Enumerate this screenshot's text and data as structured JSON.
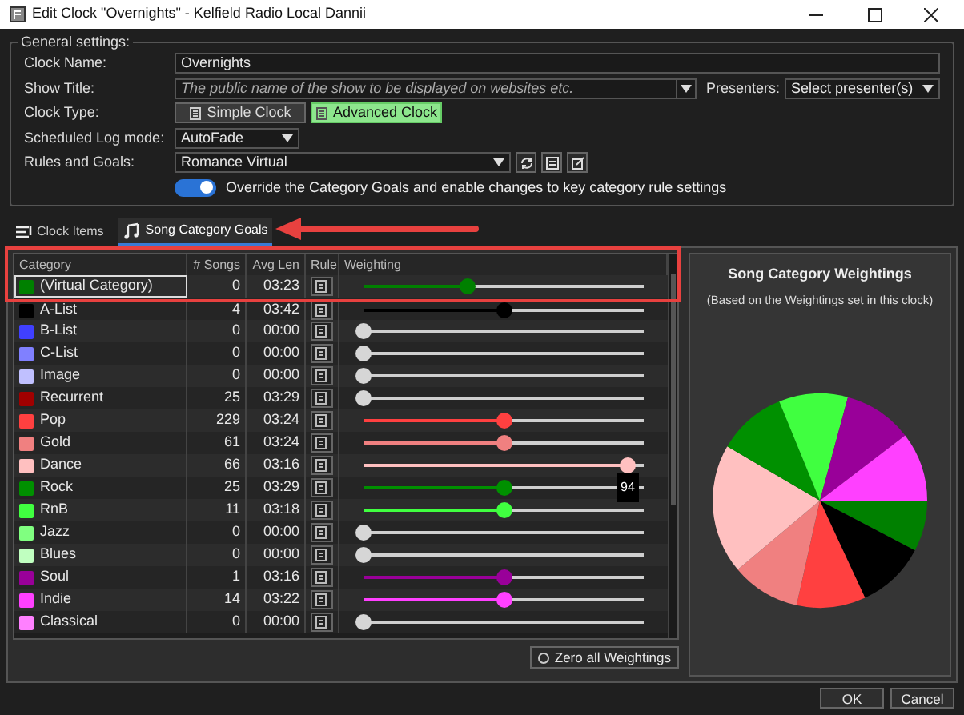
{
  "window": {
    "title": "Edit Clock \"Overnights\" - Kelfield Radio Local Dannii"
  },
  "general_settings": {
    "title": "General settings:",
    "clock_name": {
      "label": "Clock Name:",
      "value": "Overnights"
    },
    "show_title": {
      "label": "Show Title:",
      "placeholder": "The public name of the show to be displayed on websites etc."
    },
    "presenters": {
      "label": "Presenters:",
      "value": "Select presenter(s)"
    },
    "clock_type": {
      "label": "Clock Type:",
      "options": [
        {
          "label": "Simple Clock",
          "selected": false
        },
        {
          "label": "Advanced Clock",
          "selected": true
        }
      ]
    },
    "log_mode": {
      "label": "Scheduled Log mode:",
      "value": "AutoFade"
    },
    "rules": {
      "label": "Rules and Goals:",
      "value": "Romance Virtual"
    },
    "override": {
      "label": "Override the Category Goals and enable changes to key category rule settings",
      "on": true
    }
  },
  "tabs": [
    {
      "label": "Clock Items",
      "selected": false
    },
    {
      "label": "Song Category Goals",
      "selected": true
    }
  ],
  "table": {
    "columns": [
      "Category",
      "# Songs",
      "Avg Len",
      "Rule",
      "Weighting"
    ],
    "rows": [
      {
        "name": "(Virtual Category)",
        "color": "#008000",
        "songs": "0",
        "avg_len": "03:23",
        "level": 0.37,
        "selected": true
      },
      {
        "name": "A-List",
        "color": "#000000",
        "songs": "4",
        "avg_len": "03:42",
        "level": 0.5,
        "selected": false
      },
      {
        "name": "B-List",
        "color": "#4040ff",
        "songs": "0",
        "avg_len": "00:00",
        "level": 0,
        "selected": false
      },
      {
        "name": "C-List",
        "color": "#8080ff",
        "songs": "0",
        "avg_len": "00:00",
        "level": 0,
        "selected": false
      },
      {
        "name": "Image",
        "color": "#c0c0ff",
        "songs": "0",
        "avg_len": "00:00",
        "level": 0,
        "selected": false
      },
      {
        "name": "Recurrent",
        "color": "#a00000",
        "songs": "25",
        "avg_len": "03:29",
        "level": 0,
        "selected": false
      },
      {
        "name": "Pop",
        "color": "#ff4040",
        "songs": "229",
        "avg_len": "03:24",
        "level": 0.5,
        "selected": false
      },
      {
        "name": "Gold",
        "color": "#f08080",
        "songs": "61",
        "avg_len": "03:24",
        "level": 0.5,
        "selected": false
      },
      {
        "name": "Dance",
        "color": "#ffc0c0",
        "songs": "66",
        "avg_len": "03:16",
        "level": 0.94,
        "selected": false,
        "tooltip": "94"
      },
      {
        "name": "Rock",
        "color": "#009000",
        "songs": "25",
        "avg_len": "03:29",
        "level": 0.5,
        "selected": false
      },
      {
        "name": "RnB",
        "color": "#40ff40",
        "songs": "11",
        "avg_len": "03:18",
        "level": 0.5,
        "selected": false
      },
      {
        "name": "Jazz",
        "color": "#80ff80",
        "songs": "0",
        "avg_len": "00:00",
        "level": 0,
        "selected": false
      },
      {
        "name": "Blues",
        "color": "#c0ffc0",
        "songs": "0",
        "avg_len": "00:00",
        "level": 0,
        "selected": false
      },
      {
        "name": "Soul",
        "color": "#990099",
        "songs": "1",
        "avg_len": "03:16",
        "level": 0.5,
        "selected": false
      },
      {
        "name": "Indie",
        "color": "#ff40ff",
        "songs": "14",
        "avg_len": "03:22",
        "level": 0.5,
        "selected": false
      },
      {
        "name": "Classical",
        "color": "#ff80ff",
        "songs": "0",
        "avg_len": "00:00",
        "level": 0,
        "selected": false
      }
    ]
  },
  "zero_button": "Zero all Weightings",
  "chart_panel": {
    "title": "Song Category Weightings",
    "subtitle": "(Based on the Weightings set in this clock)"
  },
  "buttons": [
    "OK",
    "Cancel"
  ]
}
